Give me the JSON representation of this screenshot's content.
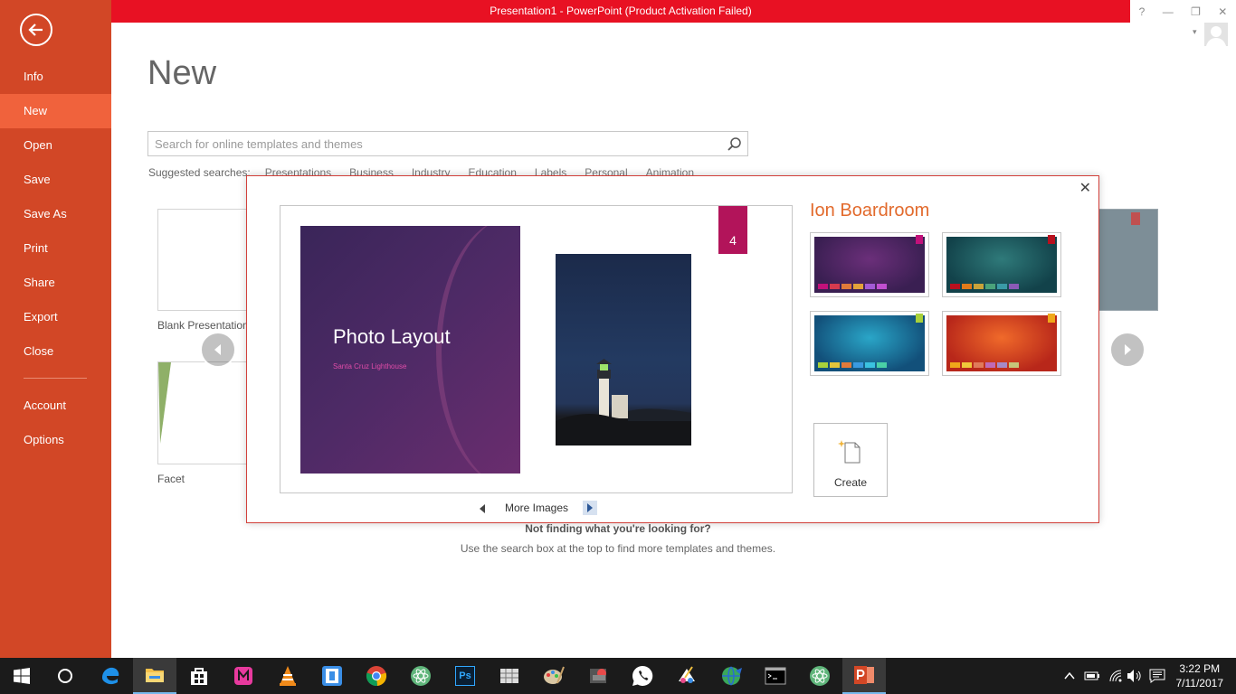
{
  "window": {
    "title": "Presentation1  -  PowerPoint (Product Activation Failed)",
    "controls": [
      "?",
      "—",
      "❐",
      "✕"
    ]
  },
  "backstage": {
    "items": [
      {
        "label": "Info"
      },
      {
        "label": "New",
        "active": true
      },
      {
        "label": "Open"
      },
      {
        "label": "Save"
      },
      {
        "label": "Save As"
      },
      {
        "label": "Print"
      },
      {
        "label": "Share"
      },
      {
        "label": "Export"
      },
      {
        "label": "Close"
      },
      {
        "label": "Account"
      },
      {
        "label": "Options"
      }
    ]
  },
  "page": {
    "title": "New",
    "search_placeholder": "Search for online templates and themes",
    "suggested_label": "Suggested searches:",
    "suggested": [
      "Presentations",
      "Business",
      "Industry",
      "Education",
      "Labels",
      "Personal",
      "Animation"
    ],
    "templates": [
      {
        "label": "Blank Presentation"
      },
      {
        "label": "Facet"
      }
    ],
    "not_finding": "Not finding what you're looking for?",
    "not_finding_sub": "Use the search box at the top to find more templates and themes."
  },
  "modal": {
    "close": "✕",
    "badge": "4",
    "slide_title": "Photo Layout",
    "slide_subtitle": "Santa Cruz Lighthouse",
    "more_images": "More Images",
    "theme_name": "Ion Boardroom",
    "create_label": "Create",
    "variants": [
      {
        "name": "purple",
        "bg": "#3a1f52",
        "glow": "#6b2f7a",
        "tag": "#c2117a",
        "swatches": [
          "#c2117a",
          "#d63a4e",
          "#e07a3a",
          "#e3a23a",
          "#a35ad6",
          "#c14fd0"
        ]
      },
      {
        "name": "teal",
        "bg": "#12424a",
        "glow": "#2f7a7a",
        "tag": "#b8101e",
        "swatches": [
          "#b8101e",
          "#e07a1a",
          "#c9a23a",
          "#4aa27a",
          "#3a9aa6",
          "#8a5ab6"
        ]
      },
      {
        "name": "blue",
        "bg": "#12507a",
        "glow": "#2aa6c8",
        "tag": "#a9d13a",
        "swatches": [
          "#a9d13a",
          "#e3c53a",
          "#e07a3a",
          "#3a9ae0",
          "#3ac2e0",
          "#4ad0a6"
        ]
      },
      {
        "name": "red",
        "bg": "#b8271a",
        "glow": "#f06a2a",
        "tag": "#f0a81a",
        "swatches": [
          "#f0a81a",
          "#f0c83a",
          "#e07a5a",
          "#c06ab6",
          "#a68ac6",
          "#c6c67a"
        ]
      }
    ]
  },
  "taskbar": {
    "apps": [
      "windows-start-icon",
      "cortana-icon",
      "edge-icon",
      "file-explorer-icon",
      "store-icon",
      "app-m-icon",
      "vlc-icon",
      "app-frame-icon",
      "chrome-icon",
      "atom-icon",
      "photoshop-icon",
      "app-grid-icon",
      "paint-icon",
      "pictures-icon",
      "whatsapp-icon",
      "paint-3d-icon",
      "globe-icon",
      "cmd-icon",
      "atom-2-icon",
      "powerpoint-icon"
    ],
    "photoshop_label": "Ps",
    "time": "3:22 PM",
    "date": "7/11/2017"
  },
  "colors": {
    "backstage": "#d24726",
    "backstage_active": "#f0623c",
    "titlebar": "#e81123",
    "theme_accent": "#e26a2c",
    "badge": "#b2145a"
  }
}
